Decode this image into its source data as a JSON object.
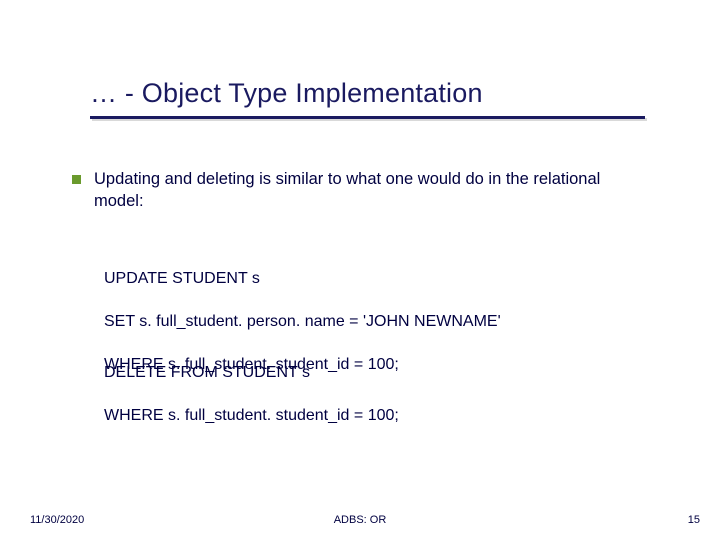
{
  "title": "… - Object Type Implementation",
  "body": "Updating and deleting is similar to what one would do in the relational model:",
  "code1": {
    "l1": "UPDATE STUDENT s",
    "l2": "SET  s. full_student. person. name = 'JOHN NEWNAME'",
    "l3": "WHERE s. full_student. student_id = 100;"
  },
  "code2": {
    "l1": "DELETE FROM STUDENT s",
    "l2": "WHERE s. full_student. student_id = 100;"
  },
  "footer": {
    "date": "11/30/2020",
    "center": "ADBS: OR",
    "num": "15"
  }
}
